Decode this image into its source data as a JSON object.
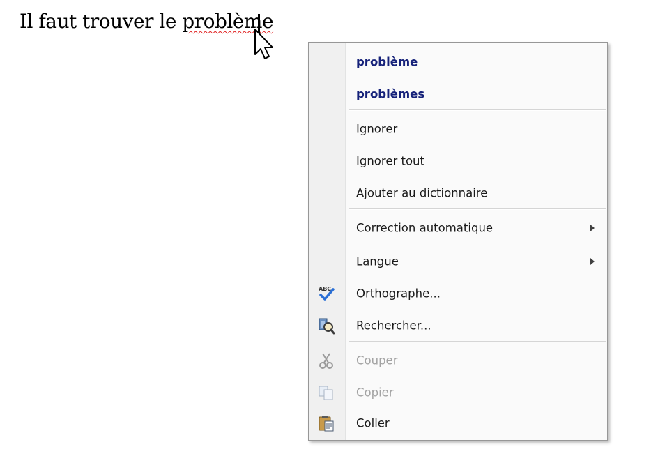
{
  "document": {
    "text_before": "Il faut trouver le ",
    "misspelled_word": "problème"
  },
  "context_menu": {
    "suggestions": [
      "problème",
      "problèmes"
    ],
    "items": [
      {
        "label": "Ignorer",
        "icon": null,
        "enabled": true
      },
      {
        "label": "Ignorer tout",
        "icon": null,
        "enabled": true
      },
      {
        "label": "Ajouter au dictionnaire",
        "icon": null,
        "enabled": true
      },
      {
        "label": "Correction automatique",
        "icon": null,
        "enabled": true,
        "submenu": true
      },
      {
        "label": "Langue",
        "icon": null,
        "enabled": true,
        "submenu": true
      },
      {
        "label": "Orthographe...",
        "icon": "spelling-check-icon",
        "enabled": true
      },
      {
        "label": "Rechercher...",
        "icon": "research-icon",
        "enabled": true
      },
      {
        "label": "Couper",
        "icon": "scissors-icon",
        "enabled": false
      },
      {
        "label": "Copier",
        "icon": "copy-icon",
        "enabled": false
      },
      {
        "label": "Coller",
        "icon": "paste-icon",
        "enabled": true
      }
    ]
  },
  "colors": {
    "suggestion_text": "#16227a",
    "disabled_text": "#a3a3a3",
    "spelling_underline": "#e02020",
    "gutter": "#f0f0f0"
  }
}
